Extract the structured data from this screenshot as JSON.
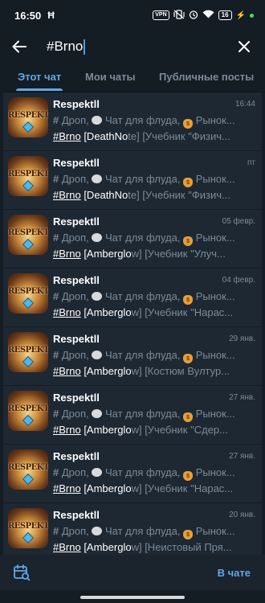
{
  "status_bar": {
    "time": "16:50",
    "app_glyph": "Ħ",
    "vpn_label": "VPN",
    "battery": "16"
  },
  "search": {
    "value": "#Brno"
  },
  "tabs": [
    {
      "label": "Этот чат",
      "active": true
    },
    {
      "label": "Мои чаты",
      "active": false
    },
    {
      "label": "Публичные посты",
      "active": false
    }
  ],
  "preview": {
    "seg1": " Дроп, ",
    "seg2": " Чат для флуда, ",
    "seg3": " Рынок..."
  },
  "results": [
    {
      "name": "Respektll",
      "avatar_text": "RESPEKTll",
      "time": "16:44",
      "tag": "#Brno",
      "bracket_open": " [DeathNo",
      "rest": "te] [Учебник \"Физич..."
    },
    {
      "name": "Respektll",
      "avatar_text": "RESPEKTll",
      "time": "пт",
      "tag": "#Brno",
      "bracket_open": " [DeathNo",
      "rest": "te] [Учебник \"Физич..."
    },
    {
      "name": "Respektll",
      "avatar_text": "RESPEKTll",
      "time": "05 февр.",
      "tag": "#Brno",
      "bracket_open": " [Amberglo",
      "rest": "w] [Учебник \"Улуч..."
    },
    {
      "name": "Respektll",
      "avatar_text": "RESPEKTll",
      "time": "04 февр.",
      "tag": "#Brno",
      "bracket_open": " [Amberglo",
      "rest": "w] [Учебник \"Нарас..."
    },
    {
      "name": "Respektll",
      "avatar_text": "RESPEKTll",
      "time": "29 янв.",
      "tag": "#Brno",
      "bracket_open": " [Amberglo",
      "rest": "w] [Костюм Вултур..."
    },
    {
      "name": "Respektll",
      "avatar_text": "RESPEKTll",
      "time": "27 янв.",
      "tag": "#Brno",
      "bracket_open": " [Amberglo",
      "rest": "w] [Учебник \"Сдер..."
    },
    {
      "name": "Respektll",
      "avatar_text": "RESPEKTll",
      "time": "27 янв.",
      "tag": "#Brno",
      "bracket_open": " [Amberglo",
      "rest": "w] [Учебник \"Нарас..."
    },
    {
      "name": "Respektll",
      "avatar_text": "RESPEKTll",
      "time": "20 янв.",
      "tag": "#Brno",
      "bracket_open": " [Amberglo",
      "rest": "w] [Неистовый Пря..."
    }
  ],
  "bottom": {
    "in_chat_label": "В чате"
  },
  "colors": {
    "background": "#141c24",
    "row": "#1e2833",
    "accent": "#5fa8e8",
    "muted": "#7c8a97"
  }
}
